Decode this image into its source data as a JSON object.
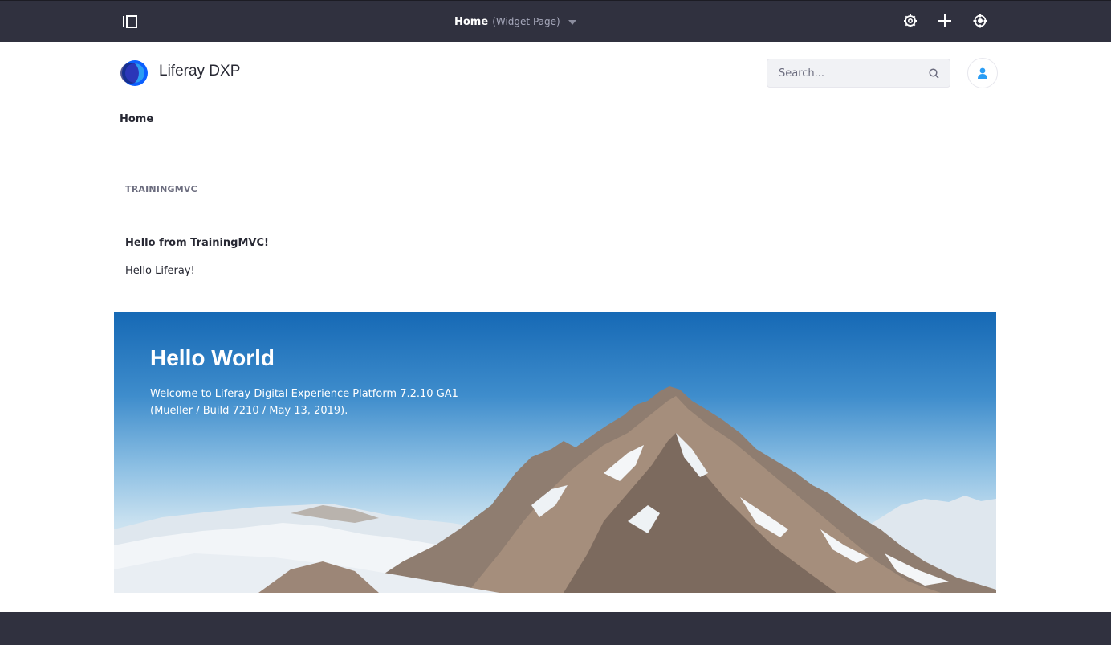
{
  "control_bar": {
    "page_title": "Home",
    "page_type": "(Widget Page)",
    "icons": [
      "product-menu-toggle-icon",
      "configure-icon",
      "add-icon",
      "simulation-icon"
    ]
  },
  "header": {
    "site_name": "Liferay DXP",
    "search": {
      "placeholder": "Search...",
      "value": ""
    },
    "nav": [
      {
        "label": "Home"
      }
    ]
  },
  "portlet": {
    "title": "TRAININGMVC",
    "heading": "Hello from TrainingMVC!",
    "text": "Hello Liferay!"
  },
  "banner": {
    "title": "Hello World",
    "description": "Welcome to Liferay Digital Experience Platform 7.2.10 GA1 (Mueller / Build 7210 / May 13, 2019)."
  },
  "colors": {
    "control_bar_bg": "#30313f",
    "accent": "#0b5fff",
    "footer_bg": "#30313f"
  }
}
